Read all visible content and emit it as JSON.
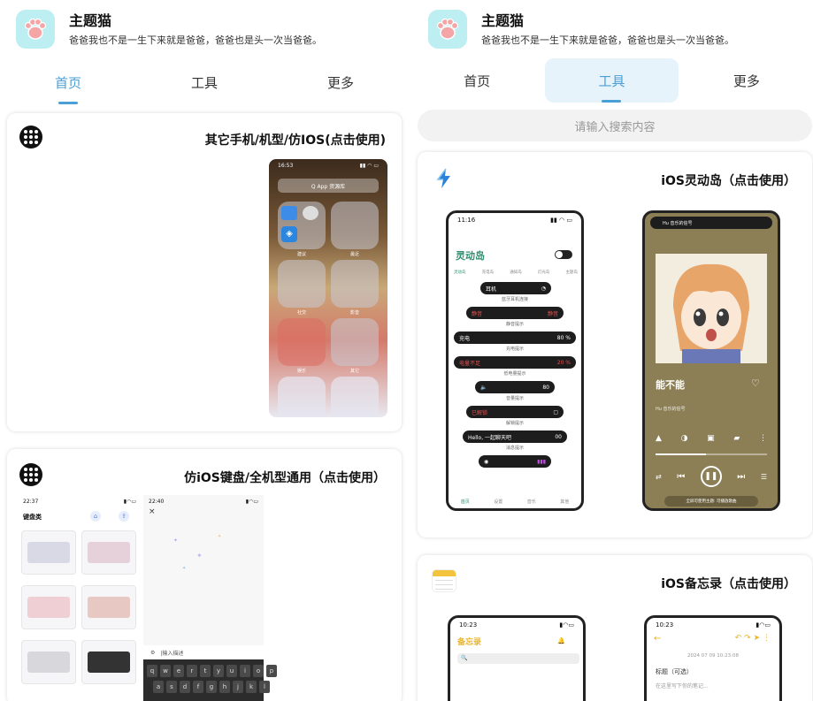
{
  "app": {
    "name": "主题猫",
    "slogan": "爸爸我也不是一生下来就是爸爸，爸爸也是头一次当爸爸。"
  },
  "tabs": [
    "首页",
    "工具",
    "更多"
  ],
  "search": {
    "placeholder": "请输入搜索内容"
  },
  "left_cards": [
    {
      "title": "其它手机/机型/仿IOS(点击使用)"
    },
    {
      "title": "仿iOS键盘/全机型通用（点击使用）"
    }
  ],
  "right_cards": [
    {
      "title": "iOS灵动岛（点击使用）"
    },
    {
      "title": "iOS备忘录（点击使用）"
    }
  ],
  "ios_shot": {
    "time": "16:53",
    "search": "Q  App 资源库",
    "folders": [
      "建议",
      "最近",
      "社交",
      "影音",
      "娱乐",
      "其它"
    ]
  },
  "keyboard_shot": {
    "time_a": "22:37",
    "time_b": "22:40",
    "page_title": "键盘类",
    "input_hint": "|输入描述",
    "row1": [
      "q",
      "w",
      "e",
      "r",
      "t",
      "y",
      "u",
      "i",
      "o",
      "p"
    ],
    "row2": [
      "a",
      "s",
      "d",
      "f",
      "g",
      "h",
      "j",
      "k",
      "l"
    ]
  },
  "island_shot": {
    "time": "11:16",
    "title": "灵动岛",
    "subtabs": [
      "灵动岛",
      "充电岛",
      "通知岛",
      "灯光岛",
      "主题岛"
    ],
    "rows": [
      {
        "left": "耳机",
        "right": "",
        "cap": "蓝牙耳机连接"
      },
      {
        "left": "静音",
        "right": "静音",
        "cap": "静音提示"
      },
      {
        "left": "充电",
        "right": "80 %",
        "cap": "充电提示"
      },
      {
        "left": "电量不足",
        "right": "20 %",
        "cap": "低电量提示"
      },
      {
        "left": "音量",
        "right": "80",
        "cap": "音量提示"
      },
      {
        "left": "已解锁",
        "right": "",
        "cap": "解锁提示"
      },
      {
        "left": "Hello, 一起聊天吧",
        "right": "00",
        "cap": "消息提示"
      }
    ],
    "nav": [
      "首页",
      "设置",
      "音乐",
      "其他"
    ]
  },
  "music_shot": {
    "song": "能不能",
    "artist": "Hu 音乐的信号",
    "footer": "全屏可使用主题: 可播放歌曲"
  },
  "notes_shot": {
    "time_a": "10:23",
    "time_b": "10:23",
    "list_title": "备忘录",
    "date": "2024 07 09 10:23:08",
    "field_title": "标题（可选）",
    "field_body": "在这里写下你的笔记..."
  },
  "colors": {
    "accent": "#4a9fd6",
    "logo_bg": "#bdeef2",
    "island_green": "#2f8f6f",
    "notes_yellow": "#e8b52c"
  }
}
